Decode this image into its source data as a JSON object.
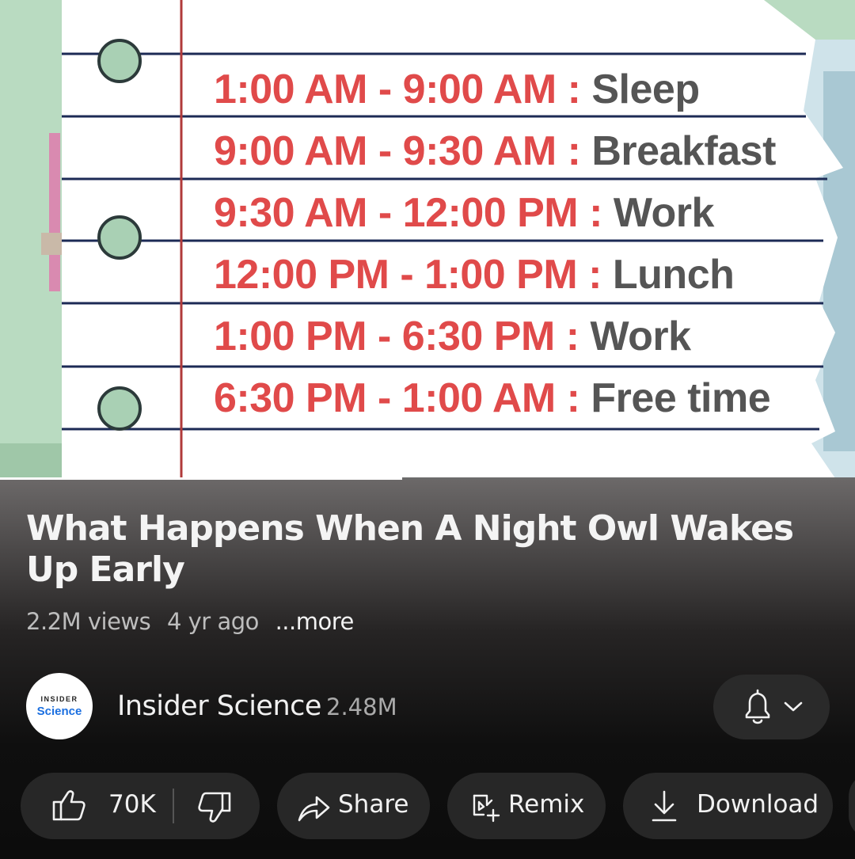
{
  "video": {
    "schedule": [
      {
        "time": "1:00 AM - 9:00 AM",
        "activity": "Sleep"
      },
      {
        "time": "9:00 AM - 9:30 AM",
        "activity": "Breakfast"
      },
      {
        "time": "9:30 AM - 12:00 PM",
        "activity": "Work"
      },
      {
        "time": "12:00 PM - 1:00 PM",
        "activity": "Lunch"
      },
      {
        "time": "1:00 PM - 6:30 PM",
        "activity": "Work"
      },
      {
        "time": "6:30 PM - 1:00 AM",
        "activity": "Free time"
      }
    ],
    "separator": ":",
    "progress": 0.47
  },
  "title": "What Happens When A Night Owl Wakes Up Early",
  "meta": {
    "views": "2.2M views",
    "age": "4 yr ago",
    "more": "...more"
  },
  "channel": {
    "logo_line1": "INSIDER",
    "logo_line2": "Science",
    "name": "Insider Science",
    "subscribers": "2.48M",
    "bell_icon": "bell-icon"
  },
  "actions": {
    "likes": "70K",
    "share": "Share",
    "remix": "Remix",
    "download": "Download"
  },
  "colors": {
    "time": "#e04a4a",
    "activity": "#555555",
    "accent_blue": "#1b6fe0"
  }
}
